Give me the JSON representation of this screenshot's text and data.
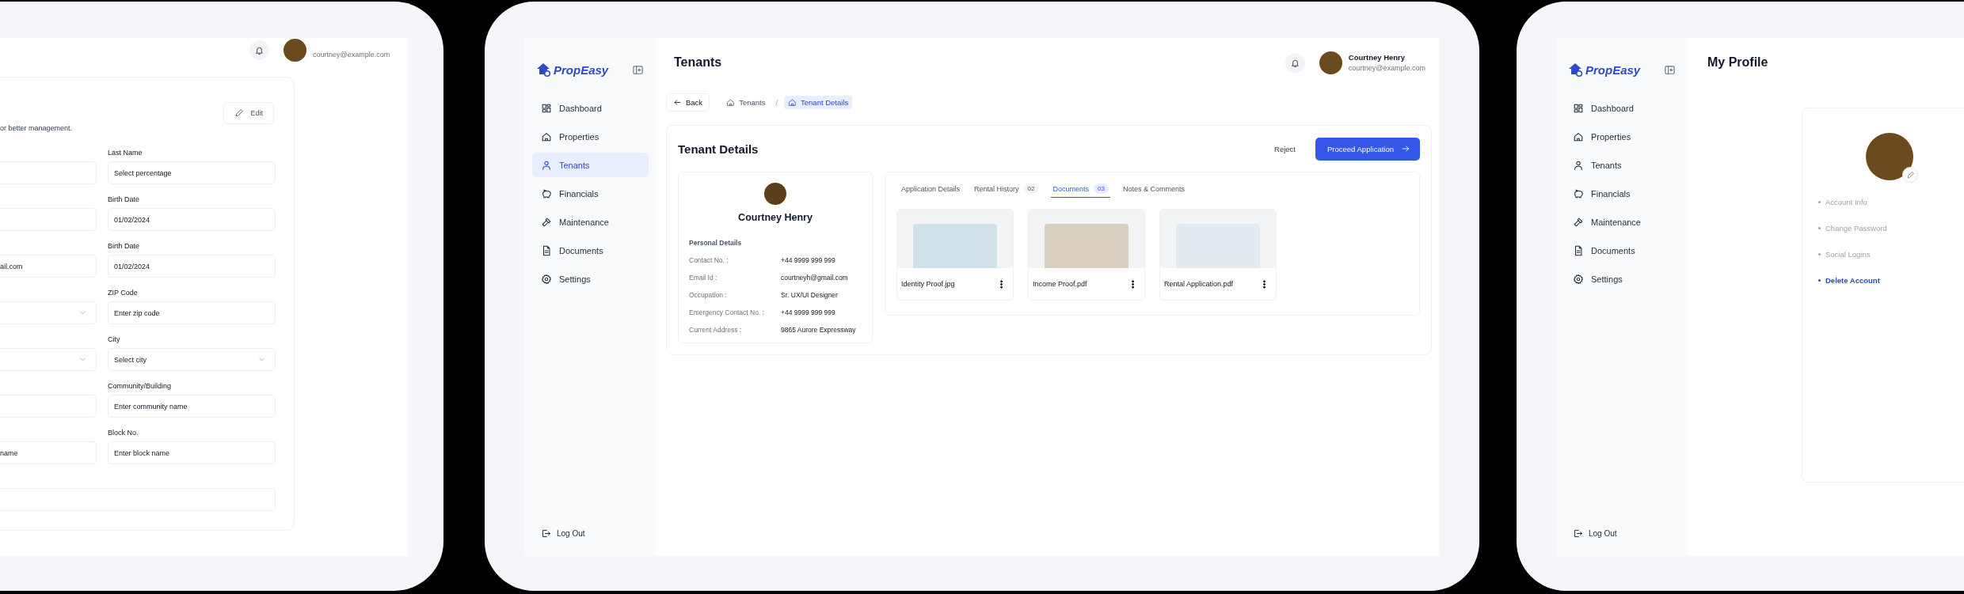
{
  "screens": [
    {
      "kind": "profile_form",
      "header": {
        "user_email": "courtney@example.com"
      },
      "card": {
        "edit_button": "Edit",
        "subtitle": "or better management.",
        "left_fields": [
          {
            "kind": "text"
          },
          {
            "kind": "text"
          },
          {
            "kind": "text",
            "value": "ail.com"
          },
          {
            "kind": "select"
          },
          {
            "kind": "select"
          },
          {
            "kind": "text"
          },
          {
            "kind": "text",
            "value": "name"
          }
        ],
        "right_fields": [
          {
            "label": "Last Name",
            "kind": "text",
            "placeholder": "Select percentage"
          },
          {
            "label": "Birth Date",
            "kind": "text",
            "value": "01/02/2024"
          },
          {
            "label": "Birth Date",
            "kind": "text",
            "value": "01/02/2024"
          },
          {
            "label": "ZIP Code",
            "kind": "text",
            "placeholder": "Enter zip code"
          },
          {
            "label": "City",
            "kind": "select",
            "placeholder": "Select city"
          },
          {
            "label": "Community/Building",
            "kind": "text",
            "placeholder": "Enter community name"
          },
          {
            "label": "Block No.",
            "kind": "text",
            "placeholder": "Enter block name"
          }
        ],
        "wide_field": {
          "kind": "text"
        }
      }
    },
    {
      "kind": "tenant_details",
      "sidebar": {
        "brand": "PropEasy",
        "items": [
          {
            "label": "Dashboard",
            "selected": false
          },
          {
            "label": "Properties",
            "selected": false
          },
          {
            "label": "Tenants",
            "selected": true
          },
          {
            "label": "Financials",
            "selected": false
          },
          {
            "label": "Maintenance",
            "selected": false
          },
          {
            "label": "Documents",
            "selected": false
          },
          {
            "label": "Settings",
            "selected": false
          }
        ],
        "logout": "Log Out"
      },
      "header": {
        "title": "Tenants",
        "user_name": "Courtney Henry",
        "user_email": "courtney@example.com"
      },
      "back_button": "Back",
      "breadcrumb": {
        "separator": "/",
        "items": [
          {
            "label": "Tenants",
            "selected": false
          },
          {
            "label": "Tenant Details",
            "selected": true
          }
        ]
      },
      "card": {
        "title": "Tenant Details",
        "reject_button": "Reject",
        "proceed_button": "Proceed Application",
        "profile": {
          "name": "Courtney Henry",
          "section": "Personal Details",
          "rows": [
            {
              "label": "Contact No. :",
              "value": "+44 9999 999 999"
            },
            {
              "label": "Email Id :",
              "value": "courtneyh@gmail.com"
            },
            {
              "label": "Occupation :",
              "value": "Sr. UX/UI Designer"
            },
            {
              "label": "Emergency Contact No. :",
              "value": "+44 9999 999 999"
            },
            {
              "label": "Current Address :",
              "value": "9865 Aurore Expressway"
            }
          ]
        },
        "tabs": [
          {
            "label": "Application Details",
            "selected": false
          },
          {
            "label": "Rental History",
            "count": "02",
            "selected": false
          },
          {
            "label": "Documents",
            "count": "03",
            "selected": true
          },
          {
            "label": "Notes & Comments",
            "selected": false
          }
        ],
        "documents": [
          {
            "name": "Identity Proof.jpg"
          },
          {
            "name": "Income Proof.pdf"
          },
          {
            "name": "Rental Application.pdf"
          }
        ]
      }
    },
    {
      "kind": "my_profile",
      "sidebar": {
        "brand": "PropEasy",
        "items": [
          {
            "label": "Dashboard",
            "selected": false
          },
          {
            "label": "Properties",
            "selected": false
          },
          {
            "label": "Tenants",
            "selected": false
          },
          {
            "label": "Financials",
            "selected": false
          },
          {
            "label": "Maintenance",
            "selected": false
          },
          {
            "label": "Documents",
            "selected": false
          },
          {
            "label": "Settings",
            "selected": false
          }
        ],
        "logout": "Log Out"
      },
      "header": {
        "title": "My Profile"
      },
      "menu": [
        {
          "label": "Account Info",
          "selected": false
        },
        {
          "label": "Change Password",
          "selected": false
        },
        {
          "label": "Social Logins",
          "selected": false
        },
        {
          "label": "Delete Account",
          "selected": true
        }
      ]
    }
  ]
}
